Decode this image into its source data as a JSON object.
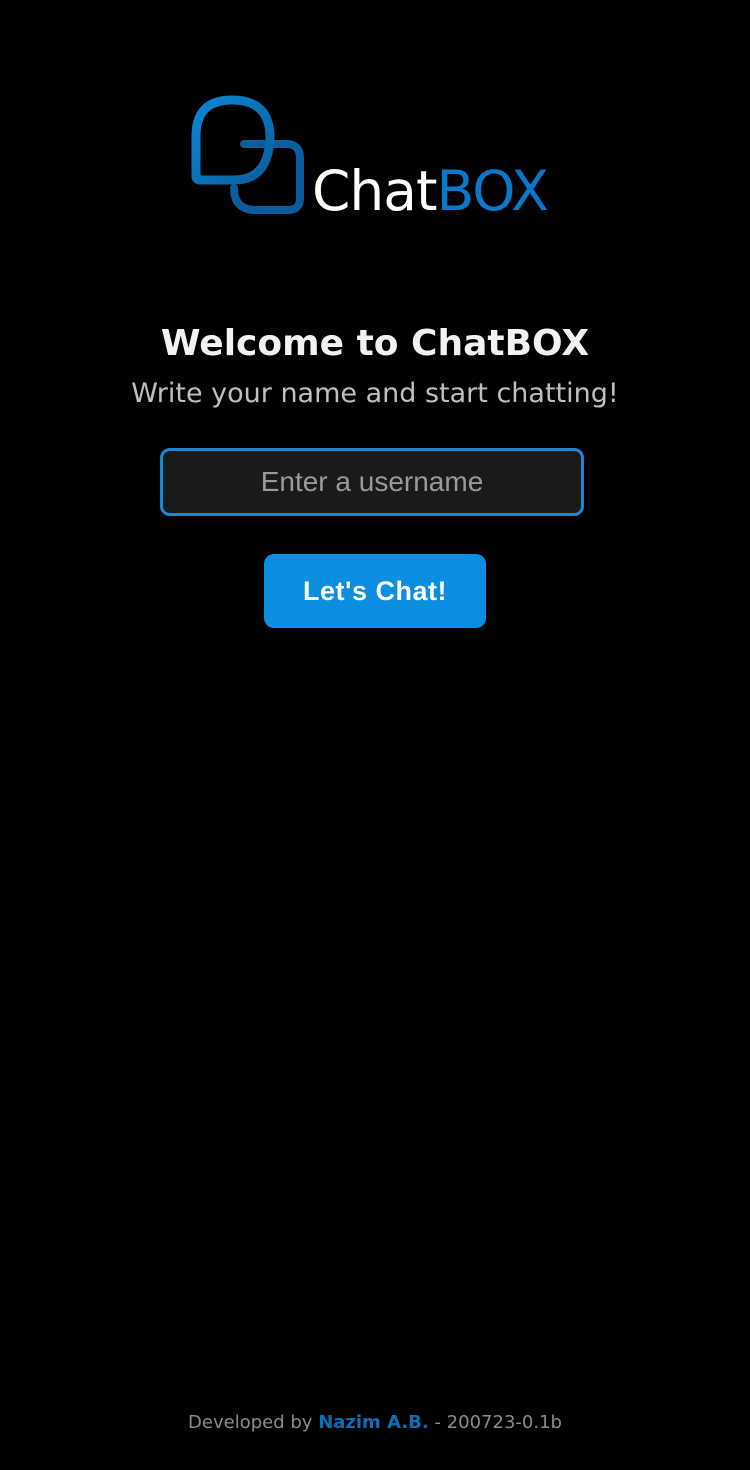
{
  "logo": {
    "part1": "Chat",
    "part2": "BOX",
    "icon": "chat-bubbles-icon"
  },
  "welcome": {
    "title": "Welcome to ChatBOX",
    "subtitle": "Write your name and start chatting!"
  },
  "form": {
    "username_value": "",
    "username_placeholder": "Enter a username",
    "submit_label": "Let's Chat!"
  },
  "footer": {
    "prefix": "Developed by",
    "author": "Nazim A.B.",
    "suffix": "- 200723-0.1b"
  },
  "colors": {
    "background": "#000000",
    "accent": "#0c8ee0",
    "logo_blue": "#0a78c8",
    "input_border": "#1789d6",
    "input_bg": "#1a1a1a"
  }
}
